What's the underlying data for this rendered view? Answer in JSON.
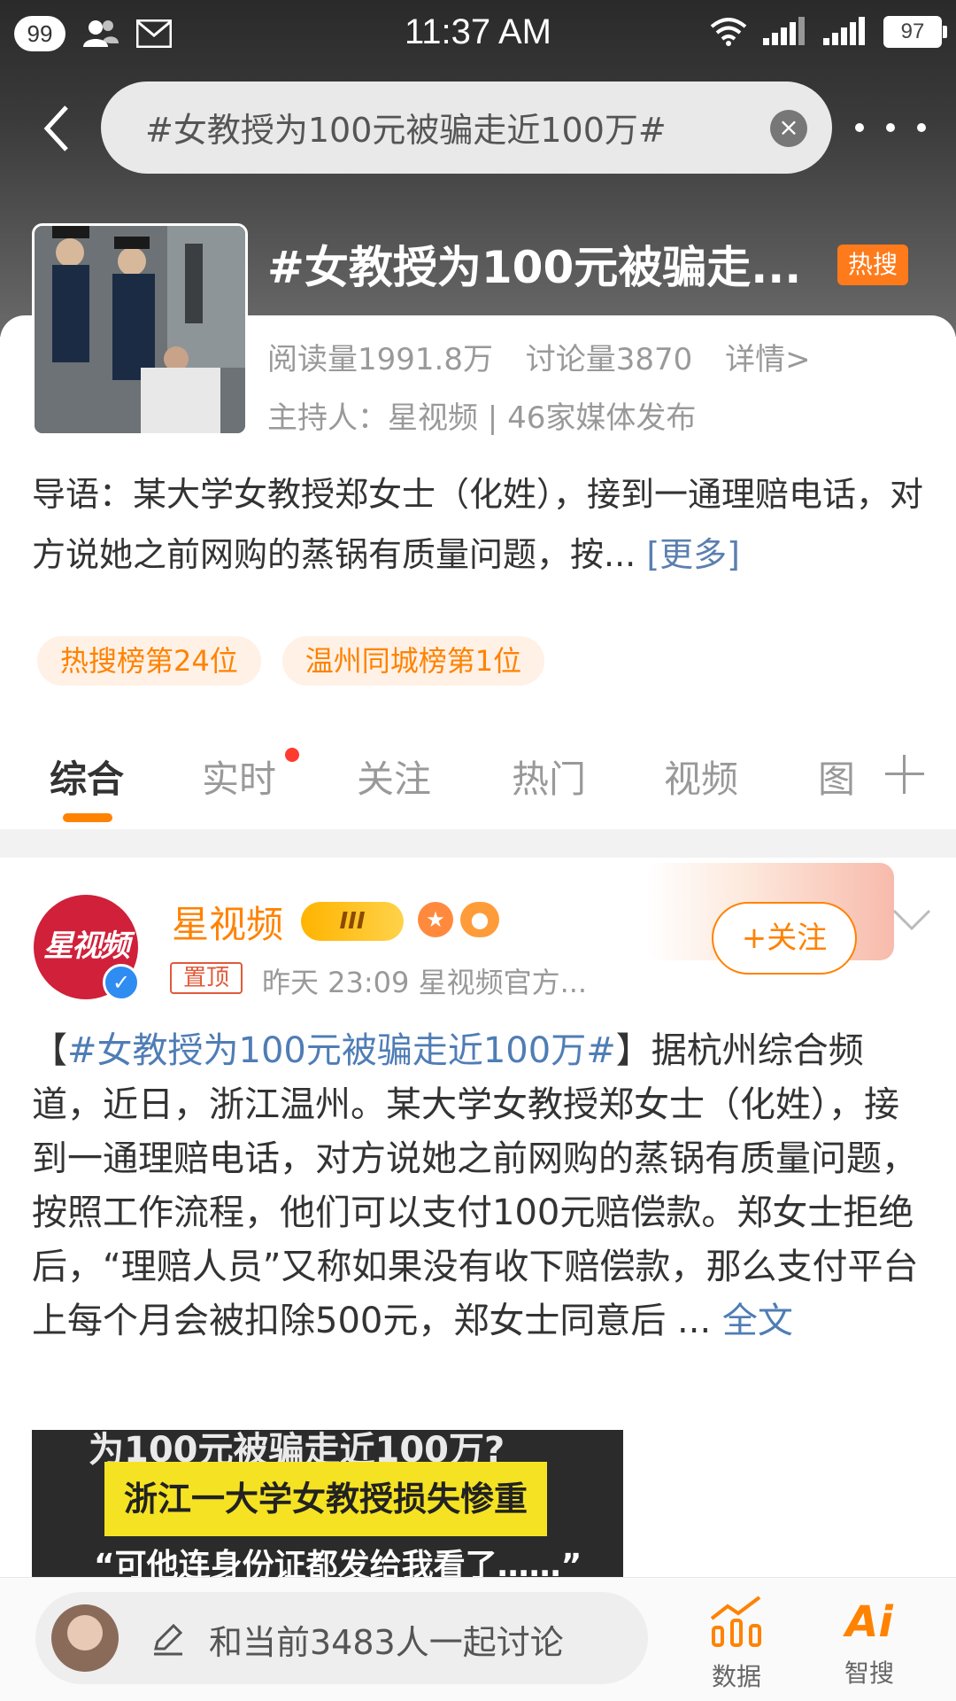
{
  "status_bar": {
    "notif_count": "99",
    "time": "11:37 AM",
    "battery": "97"
  },
  "search": {
    "query": "#女教授为100元被骗走近100万#"
  },
  "topic": {
    "title": "#女教授为100元被骗走...",
    "hot_tag": "热搜",
    "reads": "阅读量1991.8万",
    "discussions": "讨论量3870",
    "details": "详情>",
    "host": "主持人：星视频 | 46家媒体发布",
    "lead": "导语：某大学女教授郑女士（化姓），接到一通理赔电话，对方说她之前网购的蒸锅有质量问题，按...",
    "lead_more": "[更多]",
    "rank_tags": [
      "热搜榜第24位",
      "温州同城榜第1位"
    ]
  },
  "tabs": {
    "items": [
      "综合",
      "实时",
      "关注",
      "热门",
      "视频",
      "图"
    ],
    "active": "综合"
  },
  "post": {
    "avatar_text": "星视频",
    "author": "星视频",
    "vip_level": "III",
    "pin_tag": "置顶",
    "meta": "昨天 23:09   星视频官方...",
    "follow_label": "+关注",
    "text_open": "【",
    "hashtag": "#女教授为100元被骗走近100万#",
    "text_body": "】据杭州综合频道，近日，浙江温州。某大学女教授郑女士（化姓），接到一通理赔电话，对方说她之前网购的蒸锅有质量问题，按照工作流程，他们可以支付100元赔偿款。郑女士拒绝后，“理赔人员”又称如果没有收下赔偿款，那么支付平台上每个月会被扣除500元，郑女士同意后 ... ",
    "full_link": "全文",
    "video": {
      "line1": "为100元被骗走近100万?",
      "banner": "浙江一大学女教授损失惨重",
      "line3": "“可他连身份证都发给我看了……”"
    }
  },
  "bottom": {
    "comment_placeholder": "和当前3483人一起讨论",
    "data_label": "数据",
    "ai_icon": "Ai",
    "ai_label": "智搜"
  },
  "colors": {
    "accent": "#ff8200",
    "link": "#4f7db5",
    "hot": "#ff7a1a"
  }
}
